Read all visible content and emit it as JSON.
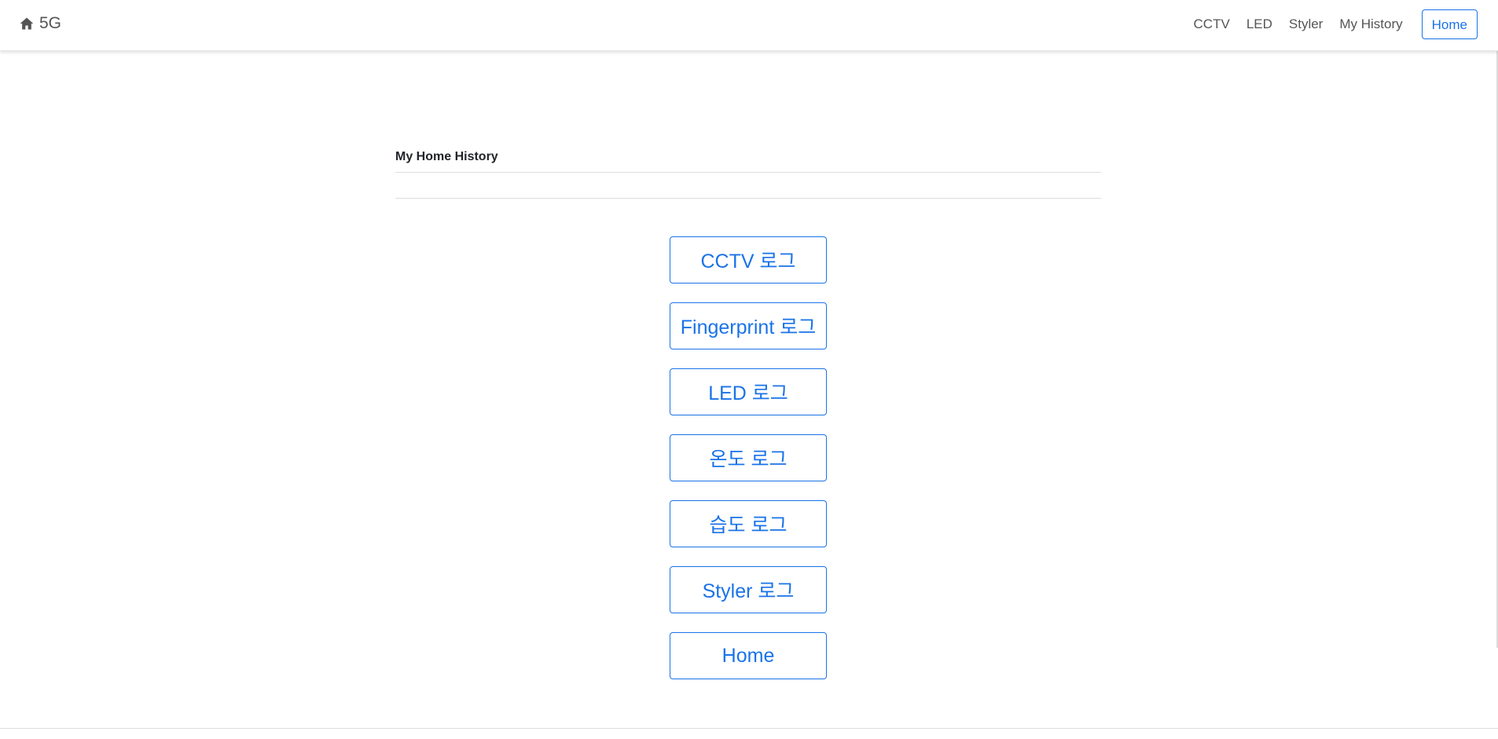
{
  "navbar": {
    "brand_icon": "home-icon",
    "brand_text": "5G",
    "links": [
      "CCTV",
      "LED",
      "Styler",
      "My History"
    ],
    "home_button": "Home"
  },
  "main": {
    "title": "My Home History",
    "buttons": [
      "CCTV 로그",
      "Fingerprint 로그",
      "LED 로그",
      "온도 로그",
      "습도 로그",
      "Styler 로그",
      "Home"
    ]
  },
  "colors": {
    "accent": "#1a73e8",
    "nav_text": "#555555"
  }
}
